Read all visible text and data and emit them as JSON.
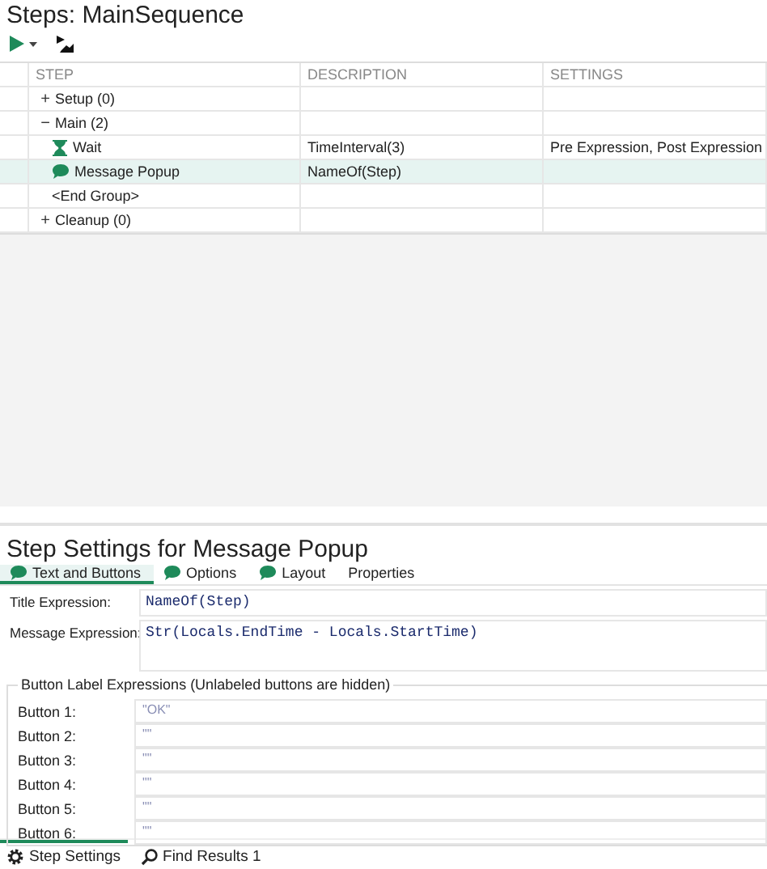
{
  "steps_panel": {
    "title": "Steps: MainSequence",
    "table": {
      "columns": [
        "STEP",
        "DESCRIPTION",
        "SETTINGS"
      ],
      "rows": [
        {
          "label": "Setup (0)",
          "kind": "group",
          "toggle": "+",
          "selected": false
        },
        {
          "label": "Main (2)",
          "kind": "group",
          "toggle": "−",
          "selected": false,
          "children": [
            {
              "label": "Wait",
              "kind": "wait",
              "selected": false,
              "description": "TimeInterval(3)",
              "settings": "Pre Expression, Post Expression"
            },
            {
              "label": "Message Popup",
              "kind": "message",
              "selected": true,
              "description": "NameOf(Step)"
            },
            {
              "label": "<End Group>",
              "kind": "end",
              "selected": false
            }
          ]
        },
        {
          "label": "Cleanup (0)",
          "kind": "group",
          "toggle": "+",
          "selected": false
        }
      ]
    }
  },
  "settings_panel": {
    "title": "Step Settings for Message Popup",
    "tabs": [
      {
        "label": "Text and Buttons",
        "kind": "message",
        "selected": true
      },
      {
        "label": "Options",
        "kind": "message",
        "selected": false
      },
      {
        "label": "Layout",
        "kind": "message",
        "selected": false
      },
      {
        "label": "Properties",
        "kind": "plain",
        "selected": false
      }
    ],
    "fields": [
      {
        "label": "Title Expression:",
        "value": "NameOf(Step)",
        "kind": "line"
      },
      {
        "label": "Message Expression:",
        "value": "Str(Locals.EndTime - Locals.StartTime)",
        "kind": "area"
      }
    ],
    "button_labels": {
      "title": "Button Label Expressions (Unlabeled buttons are hidden)",
      "rows": [
        {
          "label": "Button 1:",
          "value": "\"OK\""
        },
        {
          "label": "Button 2:",
          "value": "\"\""
        },
        {
          "label": "Button 3:",
          "value": "\"\""
        },
        {
          "label": "Button 4:",
          "value": "\"\""
        },
        {
          "label": "Button 5:",
          "value": "\"\""
        },
        {
          "label": "Button 6:",
          "value": "\"\""
        }
      ]
    }
  },
  "bottom_tabs": [
    {
      "label": "Step Settings",
      "kind": "gear",
      "selected": true
    },
    {
      "label": "Find Results 1",
      "kind": "search",
      "selected": false
    }
  ]
}
